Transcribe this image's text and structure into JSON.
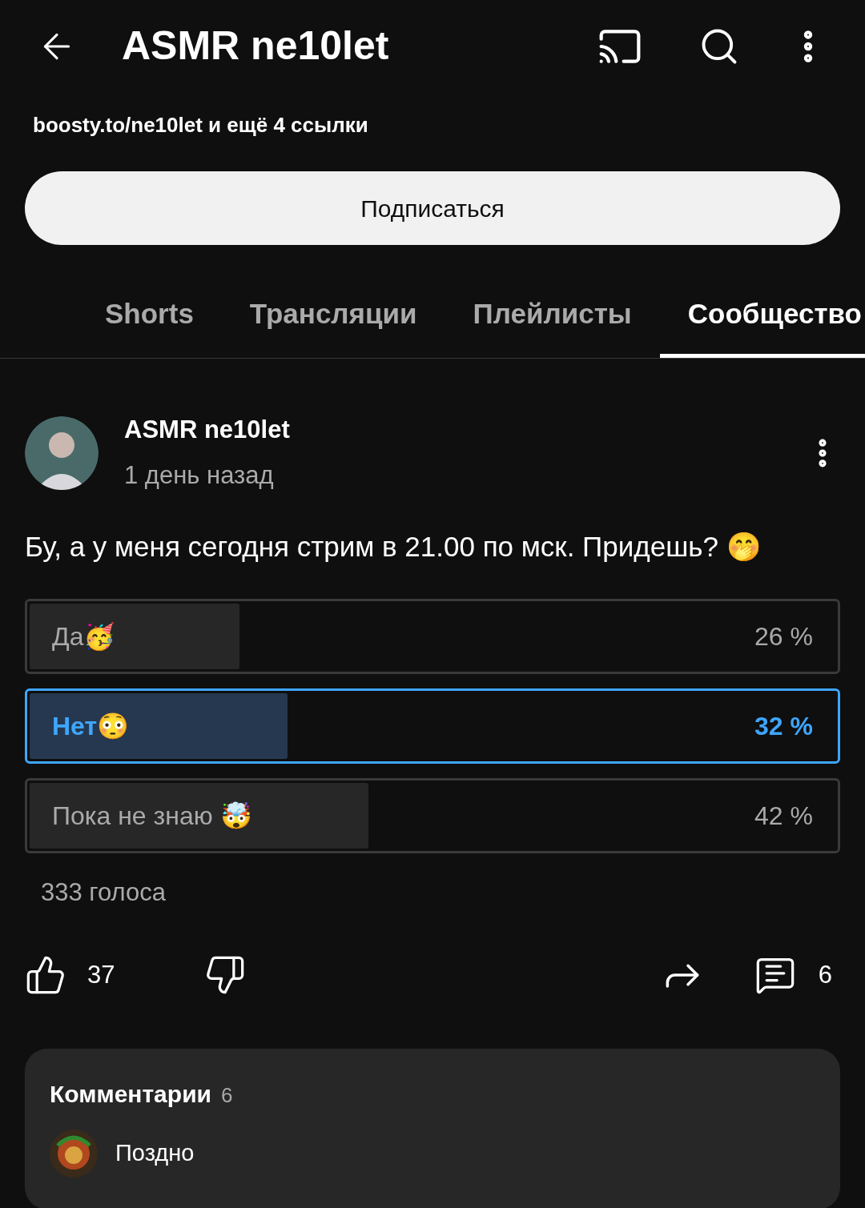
{
  "header": {
    "title": "ASMR ne10let"
  },
  "links": "boosty.to/ne10let и ещё 4 ссылки",
  "subscribe_button": "Подписаться",
  "tabs": [
    {
      "label": "Shorts",
      "selected": false
    },
    {
      "label": "Трансляции",
      "selected": false
    },
    {
      "label": "Плейлисты",
      "selected": false
    },
    {
      "label": "Сообщество",
      "selected": true
    }
  ],
  "post": {
    "author": "ASMR ne10let",
    "time": "1 день назад",
    "text": "Бу, а у меня сегодня стрим в 21.00 по мск. Придешь? 🤭",
    "poll": [
      {
        "label": "Да🥳",
        "percent": "26 %",
        "level": 0.26,
        "selected": false
      },
      {
        "label": "Нет😳",
        "percent": "32 %",
        "level": 0.32,
        "selected": true
      },
      {
        "label": "Пока не знаю 🤯",
        "percent": "42 %",
        "level": 0.42,
        "selected": false
      }
    ],
    "votes": "333 голоса",
    "likes": "37",
    "comments_count": "6"
  },
  "comments": {
    "title": "Комментарии",
    "count": "6",
    "first": "Поздно"
  }
}
